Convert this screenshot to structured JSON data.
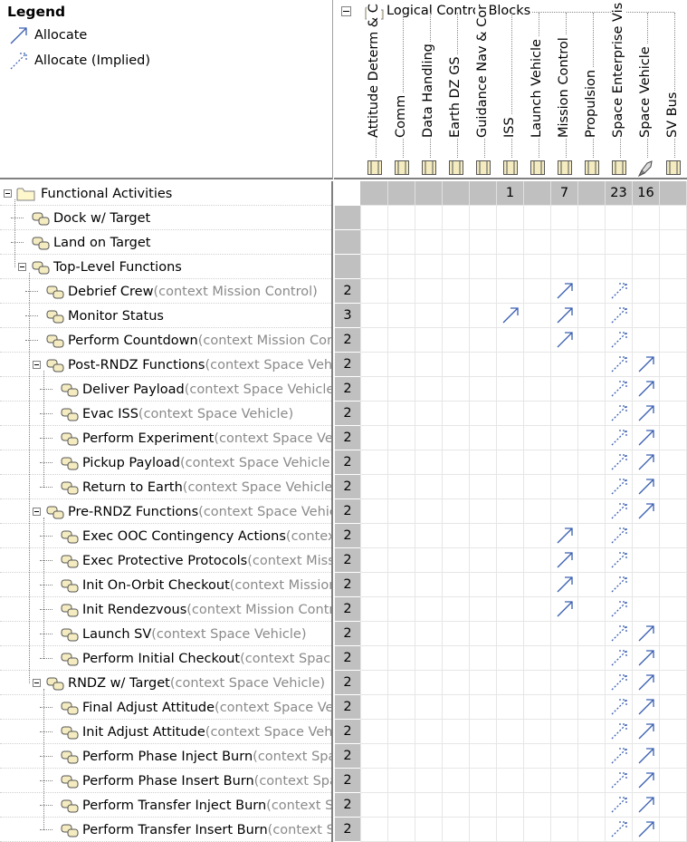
{
  "legend": {
    "title": "Legend",
    "items": [
      {
        "label": "Allocate",
        "style": "solid"
      },
      {
        "label": "Allocate (Implied)",
        "style": "dashed"
      }
    ]
  },
  "columns_group": "Logical Control Blocks",
  "columns": [
    {
      "label": "Attitude Determ & C",
      "icon": "block-icon",
      "count": ""
    },
    {
      "label": "Comm",
      "icon": "block-icon",
      "count": ""
    },
    {
      "label": "Data Handling",
      "icon": "block-icon",
      "count": ""
    },
    {
      "label": "Earth DZ GS",
      "icon": "block-icon",
      "count": ""
    },
    {
      "label": "Guidance Nav & Cor",
      "icon": "block-icon",
      "count": ""
    },
    {
      "label": "ISS",
      "icon": "block-icon",
      "count": "1"
    },
    {
      "label": "Launch Vehicle",
      "icon": "block-icon",
      "count": ""
    },
    {
      "label": "Mission Control",
      "icon": "block-icon",
      "count": "7"
    },
    {
      "label": "Propulsion",
      "icon": "block-icon",
      "count": ""
    },
    {
      "label": "Space Enterprise Vis",
      "icon": "block-icon",
      "count": "23"
    },
    {
      "label": "Space Vehicle",
      "icon": "rocket-icon",
      "count": "16"
    },
    {
      "label": "SV Bus",
      "icon": "block-icon",
      "count": ""
    }
  ],
  "rows": [
    {
      "name": "Functional Activities",
      "ctx": "",
      "level": 0,
      "kind": "folder",
      "expander": true,
      "count": "",
      "cells": []
    },
    {
      "name": "Dock w/ Target",
      "ctx": "",
      "level": 1,
      "kind": "activity",
      "expander": false,
      "count": "",
      "cells": []
    },
    {
      "name": "Land on Target",
      "ctx": "",
      "level": 1,
      "kind": "activity",
      "expander": false,
      "count": "",
      "cells": []
    },
    {
      "name": "Top-Level Functions",
      "ctx": "",
      "level": 1,
      "kind": "activity",
      "expander": true,
      "count": "",
      "cells": []
    },
    {
      "name": "Debrief Crew",
      "ctx": "(context Mission Control)",
      "level": 2,
      "kind": "activity",
      "expander": false,
      "count": "2",
      "cells": [
        [
          7,
          "solid"
        ],
        [
          9,
          "dashed"
        ]
      ]
    },
    {
      "name": "Monitor Status",
      "ctx": "",
      "level": 2,
      "kind": "activity",
      "expander": false,
      "count": "3",
      "cells": [
        [
          5,
          "solid"
        ],
        [
          7,
          "solid"
        ],
        [
          9,
          "dashed"
        ]
      ]
    },
    {
      "name": "Perform Countdown",
      "ctx": "(context Mission Control)",
      "level": 2,
      "kind": "activity",
      "expander": false,
      "count": "2",
      "cells": [
        [
          7,
          "solid"
        ],
        [
          9,
          "dashed"
        ]
      ]
    },
    {
      "name": "Post-RNDZ Functions",
      "ctx": "(context Space Vehicle)",
      "level": 2,
      "kind": "activity",
      "expander": true,
      "count": "2",
      "cells": [
        [
          9,
          "dashed"
        ],
        [
          10,
          "solid"
        ]
      ]
    },
    {
      "name": "Deliver Payload",
      "ctx": "(context Space Vehicle)",
      "level": 3,
      "kind": "activity",
      "expander": false,
      "count": "2",
      "cells": [
        [
          9,
          "dashed"
        ],
        [
          10,
          "solid"
        ]
      ]
    },
    {
      "name": "Evac ISS",
      "ctx": "(context Space Vehicle)",
      "level": 3,
      "kind": "activity",
      "expander": false,
      "count": "2",
      "cells": [
        [
          9,
          "dashed"
        ],
        [
          10,
          "solid"
        ]
      ]
    },
    {
      "name": "Perform Experiment",
      "ctx": "(context Space Vehicle)",
      "level": 3,
      "kind": "activity",
      "expander": false,
      "count": "2",
      "cells": [
        [
          9,
          "dashed"
        ],
        [
          10,
          "solid"
        ]
      ]
    },
    {
      "name": "Pickup Payload",
      "ctx": "(context Space Vehicle)",
      "level": 3,
      "kind": "activity",
      "expander": false,
      "count": "2",
      "cells": [
        [
          9,
          "dashed"
        ],
        [
          10,
          "solid"
        ]
      ]
    },
    {
      "name": "Return to Earth",
      "ctx": "(context Space Vehicle)",
      "level": 3,
      "kind": "activity",
      "expander": false,
      "count": "2",
      "cells": [
        [
          9,
          "dashed"
        ],
        [
          10,
          "solid"
        ]
      ]
    },
    {
      "name": "Pre-RNDZ Functions",
      "ctx": "(context Space Vehicle)",
      "level": 2,
      "kind": "activity",
      "expander": true,
      "count": "2",
      "cells": [
        [
          9,
          "dashed"
        ],
        [
          10,
          "solid"
        ]
      ]
    },
    {
      "name": "Exec OOC Contingency Actions",
      "ctx": "(context Mission Control)",
      "level": 3,
      "kind": "activity",
      "expander": false,
      "count": "2",
      "cells": [
        [
          7,
          "solid"
        ],
        [
          9,
          "dashed"
        ]
      ]
    },
    {
      "name": "Exec Protective Protocols",
      "ctx": "(context Mission Control)",
      "level": 3,
      "kind": "activity",
      "expander": false,
      "count": "2",
      "cells": [
        [
          7,
          "solid"
        ],
        [
          9,
          "dashed"
        ]
      ]
    },
    {
      "name": "Init On-Orbit Checkout",
      "ctx": "(context Mission Control)",
      "level": 3,
      "kind": "activity",
      "expander": false,
      "count": "2",
      "cells": [
        [
          7,
          "solid"
        ],
        [
          9,
          "dashed"
        ]
      ]
    },
    {
      "name": "Init Rendezvous",
      "ctx": "(context Mission Control)",
      "level": 3,
      "kind": "activity",
      "expander": false,
      "count": "2",
      "cells": [
        [
          7,
          "solid"
        ],
        [
          9,
          "dashed"
        ]
      ]
    },
    {
      "name": "Launch SV",
      "ctx": "(context Space Vehicle)",
      "level": 3,
      "kind": "activity",
      "expander": false,
      "count": "2",
      "cells": [
        [
          9,
          "dashed"
        ],
        [
          10,
          "solid"
        ]
      ]
    },
    {
      "name": "Perform Initial Checkout",
      "ctx": "(context Space Vehicle)",
      "level": 3,
      "kind": "activity",
      "expander": false,
      "count": "2",
      "cells": [
        [
          9,
          "dashed"
        ],
        [
          10,
          "solid"
        ]
      ]
    },
    {
      "name": "RNDZ w/ Target",
      "ctx": "(context Space Vehicle)",
      "level": 2,
      "kind": "activity",
      "expander": true,
      "count": "2",
      "cells": [
        [
          9,
          "dashed"
        ],
        [
          10,
          "solid"
        ]
      ]
    },
    {
      "name": "Final Adjust Attitude",
      "ctx": "(context Space Vehicle)",
      "level": 3,
      "kind": "activity",
      "expander": false,
      "count": "2",
      "cells": [
        [
          9,
          "dashed"
        ],
        [
          10,
          "solid"
        ]
      ]
    },
    {
      "name": "Init Adjust Attitude",
      "ctx": "(context Space Vehicle)",
      "level": 3,
      "kind": "activity",
      "expander": false,
      "count": "2",
      "cells": [
        [
          9,
          "dashed"
        ],
        [
          10,
          "solid"
        ]
      ]
    },
    {
      "name": "Perform Phase Inject Burn",
      "ctx": "(context Space Vehicle)",
      "level": 3,
      "kind": "activity",
      "expander": false,
      "count": "2",
      "cells": [
        [
          9,
          "dashed"
        ],
        [
          10,
          "solid"
        ]
      ]
    },
    {
      "name": "Perform Phase Insert Burn",
      "ctx": "(context Space Vehicle)",
      "level": 3,
      "kind": "activity",
      "expander": false,
      "count": "2",
      "cells": [
        [
          9,
          "dashed"
        ],
        [
          10,
          "solid"
        ]
      ]
    },
    {
      "name": "Perform Transfer Inject Burn",
      "ctx": "(context Space Vehicle)",
      "level": 3,
      "kind": "activity",
      "expander": false,
      "count": "2",
      "cells": [
        [
          9,
          "dashed"
        ],
        [
          10,
          "solid"
        ]
      ]
    },
    {
      "name": "Perform Transfer Insert Burn",
      "ctx": "(context Space Vehicle)",
      "level": 3,
      "kind": "activity",
      "expander": false,
      "count": "2",
      "cells": [
        [
          9,
          "dashed"
        ],
        [
          10,
          "solid"
        ]
      ]
    }
  ],
  "colors": {
    "arrow": "#3a5fb0",
    "count_bg": "#c0c0c0",
    "context_text": "#8a8a8a"
  }
}
